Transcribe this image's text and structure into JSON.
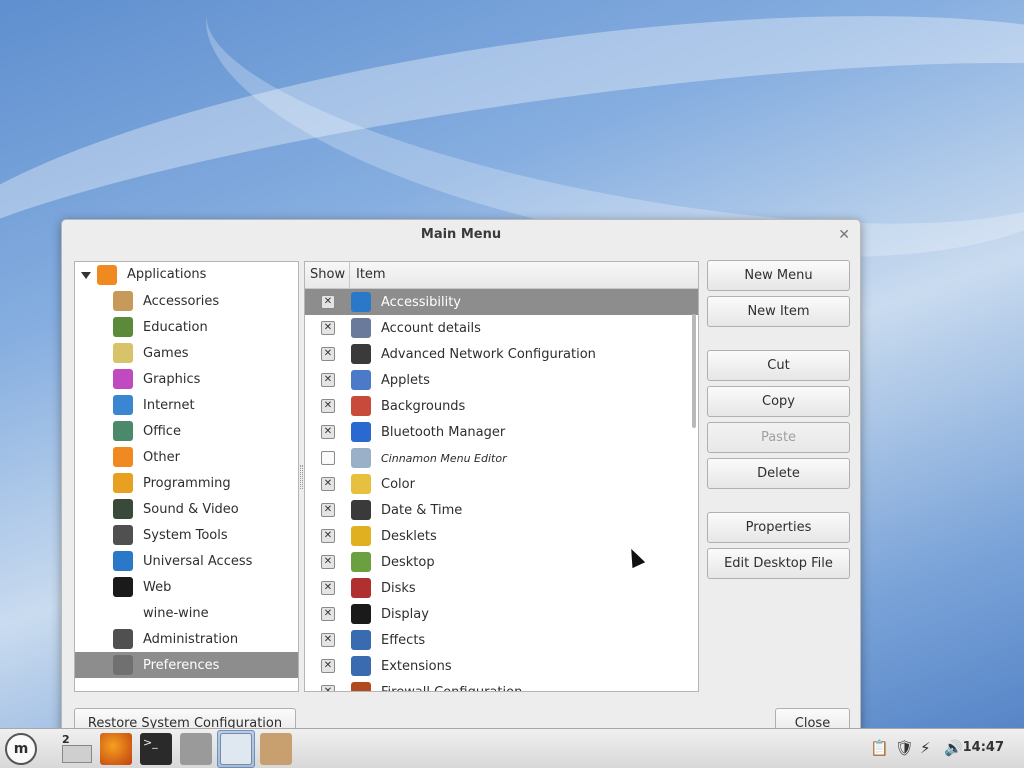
{
  "window": {
    "title": "Main Menu"
  },
  "tree": {
    "root": {
      "label": "Applications",
      "icon": "applications-icon"
    },
    "items": [
      {
        "label": "Accessories",
        "icon": "accessories-icon",
        "color": "#c89a5a"
      },
      {
        "label": "Education",
        "icon": "education-icon",
        "color": "#5a8a3a"
      },
      {
        "label": "Games",
        "icon": "games-icon",
        "color": "#d9c36a"
      },
      {
        "label": "Graphics",
        "icon": "graphics-icon",
        "color": "#c04ac0"
      },
      {
        "label": "Internet",
        "icon": "internet-icon",
        "color": "#3a86d0"
      },
      {
        "label": "Office",
        "icon": "office-icon",
        "color": "#4a8a6a"
      },
      {
        "label": "Other",
        "icon": "other-icon",
        "color": "#f08a20"
      },
      {
        "label": "Programming",
        "icon": "programming-icon",
        "color": "#e8a020"
      },
      {
        "label": "Sound & Video",
        "icon": "sound-video-icon",
        "color": "#3a4a3a"
      },
      {
        "label": "System Tools",
        "icon": "system-tools-icon",
        "color": "#505050"
      },
      {
        "label": "Universal Access",
        "icon": "universal-access-icon",
        "color": "#2a78c8"
      },
      {
        "label": "Web",
        "icon": "web-icon",
        "color": "#1a1a1a"
      },
      {
        "label": "wine-wine",
        "icon": "",
        "color": ""
      },
      {
        "label": "Administration",
        "icon": "administration-icon",
        "color": "#505050"
      },
      {
        "label": "Preferences",
        "icon": "preferences-icon",
        "color": "#707070",
        "selected": true
      }
    ]
  },
  "list": {
    "headers": {
      "show": "Show",
      "item": "Item"
    },
    "rows": [
      {
        "label": "Accessibility",
        "checked": true,
        "icon": "accessibility-icon",
        "color": "#2a78c8",
        "selected": true
      },
      {
        "label": "Account details",
        "checked": true,
        "icon": "account-icon",
        "color": "#6a7a9a"
      },
      {
        "label": "Advanced Network Configuration",
        "checked": true,
        "icon": "network-icon",
        "color": "#3a3a3a"
      },
      {
        "label": "Applets",
        "checked": true,
        "icon": "applets-icon",
        "color": "#4a7ac8"
      },
      {
        "label": "Backgrounds",
        "checked": true,
        "icon": "backgrounds-icon",
        "color": "#c84a3a"
      },
      {
        "label": "Bluetooth Manager",
        "checked": true,
        "icon": "bluetooth-icon",
        "color": "#2a6ad0"
      },
      {
        "label": "Cinnamon Menu Editor",
        "checked": false,
        "icon": "menu-editor-icon",
        "color": "#9ab0c8",
        "italic": true
      },
      {
        "label": "Color",
        "checked": true,
        "icon": "color-icon",
        "color": "#e8c040"
      },
      {
        "label": "Date & Time",
        "checked": true,
        "icon": "date-time-icon",
        "color": "#3a3a3a"
      },
      {
        "label": "Desklets",
        "checked": true,
        "icon": "desklets-icon",
        "color": "#e0b020"
      },
      {
        "label": "Desktop",
        "checked": true,
        "icon": "desktop-icon",
        "color": "#6aa040"
      },
      {
        "label": "Disks",
        "checked": true,
        "icon": "disks-icon",
        "color": "#b03030"
      },
      {
        "label": "Display",
        "checked": true,
        "icon": "display-icon",
        "color": "#1a1a1a"
      },
      {
        "label": "Effects",
        "checked": true,
        "icon": "effects-icon",
        "color": "#3a6ab0"
      },
      {
        "label": "Extensions",
        "checked": true,
        "icon": "extensions-icon",
        "color": "#3a6ab0"
      },
      {
        "label": "Firewall Configuration",
        "checked": true,
        "icon": "firewall-icon",
        "color": "#b04a20"
      }
    ]
  },
  "buttons": {
    "new_menu": "New Menu",
    "new_item": "New Item",
    "cut": "Cut",
    "copy": "Copy",
    "paste": "Paste",
    "delete": "Delete",
    "properties": "Properties",
    "edit_desktop_file": "Edit Desktop File",
    "restore": "Restore System Configuration",
    "close": "Close"
  },
  "taskbar": {
    "workspace_number": "2",
    "clock": "14:47"
  }
}
